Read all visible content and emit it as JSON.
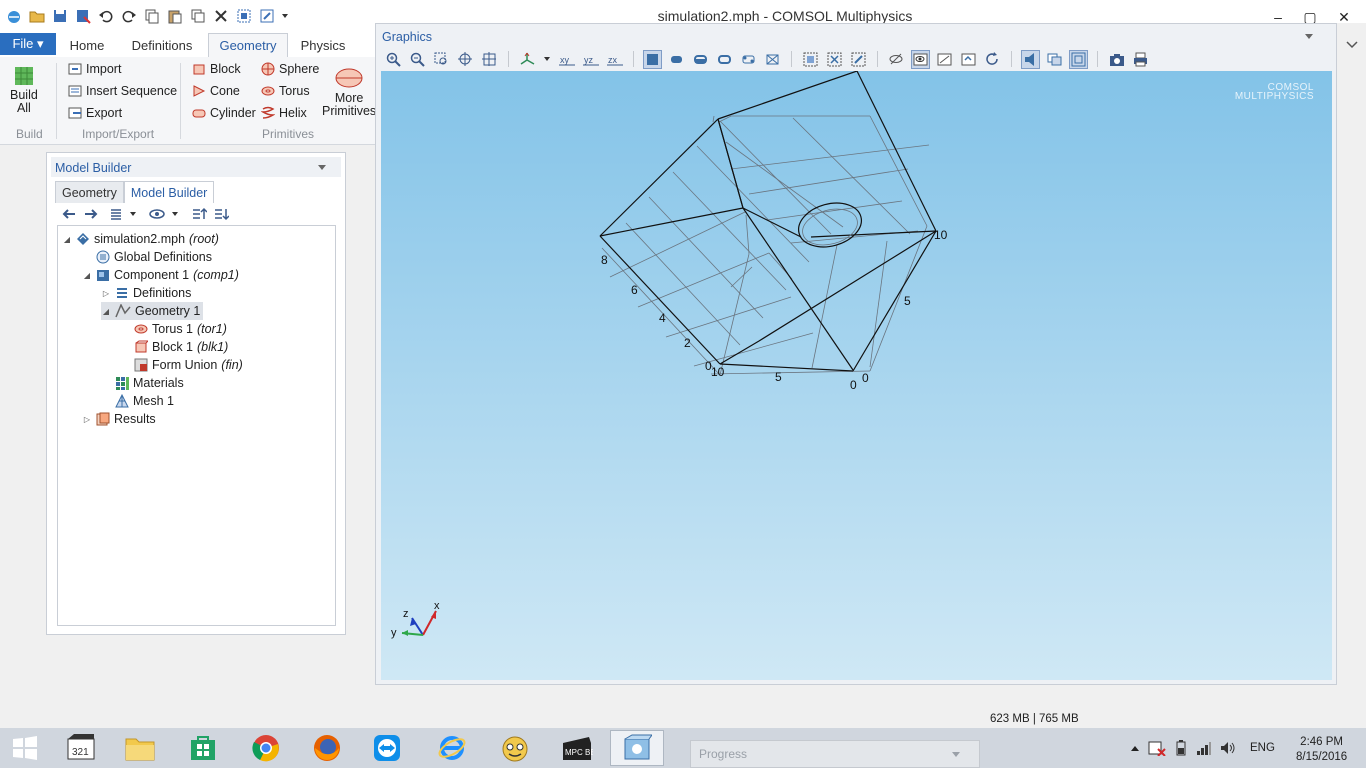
{
  "window": {
    "title": "simulation2.mph - COMSOL Multiphysics",
    "controls": {
      "minimize": "–",
      "maximize": "▢",
      "close": "✕"
    }
  },
  "quick_access": [
    "open-icon",
    "save-icon",
    "save-as-icon",
    "undo-icon",
    "redo-icon",
    "copy-icon",
    "paste-icon",
    "duplicate-icon",
    "delete-icon",
    "select-icon",
    "settings-icon",
    "dropdown-icon"
  ],
  "ribbon": {
    "file_label": "File ▾",
    "tabs": [
      "Home",
      "Definitions",
      "Geometry",
      "Physics"
    ],
    "active_tab": "Geometry",
    "build_all": "Build\nAll",
    "groups": {
      "build": "Build",
      "import_export": "Import/Export",
      "primitives": "Primitives"
    },
    "import_export": {
      "import": "Import",
      "insert_sequence": "Insert Sequence",
      "export": "Export"
    },
    "primitives": {
      "block": "Block",
      "cone": "Cone",
      "cylinder": "Cylinder",
      "sphere": "Sphere",
      "torus": "Torus",
      "helix": "Helix",
      "more": "More\nPrimitives"
    }
  },
  "model_builder": {
    "header": "Model Builder",
    "tabs": [
      "Geometry",
      "Model Builder"
    ],
    "active_tab": "Model Builder",
    "tree": [
      {
        "label": "simulation2.mph",
        "tag": "(root)",
        "icon": "root-icon",
        "toggle": "◢"
      },
      {
        "label": "Global Definitions",
        "tag": "",
        "icon": "global-definitions-icon",
        "toggle": ""
      },
      {
        "label": "Component 1",
        "tag": "(comp1)",
        "icon": "component-icon",
        "toggle": "◢"
      },
      {
        "label": "Definitions",
        "tag": "",
        "icon": "definitions-icon",
        "toggle": "▷"
      },
      {
        "label": "Geometry 1",
        "tag": "",
        "icon": "geometry-icon",
        "toggle": "◢"
      },
      {
        "label": "Torus 1",
        "tag": "(tor1)",
        "icon": "torus-icon",
        "toggle": ""
      },
      {
        "label": "Block 1",
        "tag": "(blk1)",
        "icon": "block-icon",
        "toggle": ""
      },
      {
        "label": "Form Union",
        "tag": "(fin)",
        "icon": "form-union-icon",
        "toggle": ""
      },
      {
        "label": "Materials",
        "tag": "",
        "icon": "materials-icon",
        "toggle": ""
      },
      {
        "label": "Mesh 1",
        "tag": "",
        "icon": "mesh-icon",
        "toggle": ""
      },
      {
        "label": "Results",
        "tag": "",
        "icon": "results-icon",
        "toggle": "▷"
      }
    ],
    "selected": "Geometry 1"
  },
  "graphics": {
    "title": "Graphics",
    "logo_line1": "COMSOL",
    "logo_line2": "MULTIPHYSICS",
    "scale_labels": {
      "y8": "8",
      "y6": "6",
      "y4": "4",
      "y2": "2",
      "y0": "0",
      "x10a": "10",
      "x5": "5",
      "x0a": "0",
      "z0": "0",
      "z5": "5",
      "z10": "10"
    },
    "triad": {
      "z": "z",
      "x": "x",
      "y": "y"
    }
  },
  "status": {
    "memory": "623 MB | 765 MB",
    "progress_label": "Progress"
  },
  "taskbar": {
    "apps": [
      "start-button",
      "321-player",
      "file-explorer",
      "store",
      "chrome",
      "firefox",
      "teamviewer",
      "internet-explorer",
      "gom-player",
      "mpc-be",
      "comsol"
    ],
    "language": "ENG",
    "time": "2:46 PM",
    "date": "8/15/2016"
  },
  "colors": {
    "accent": "#2b5ea5",
    "file_tab": "#2a6ebf",
    "canvas_top": "#83c3e8",
    "canvas_bottom": "#cfe8f5"
  }
}
